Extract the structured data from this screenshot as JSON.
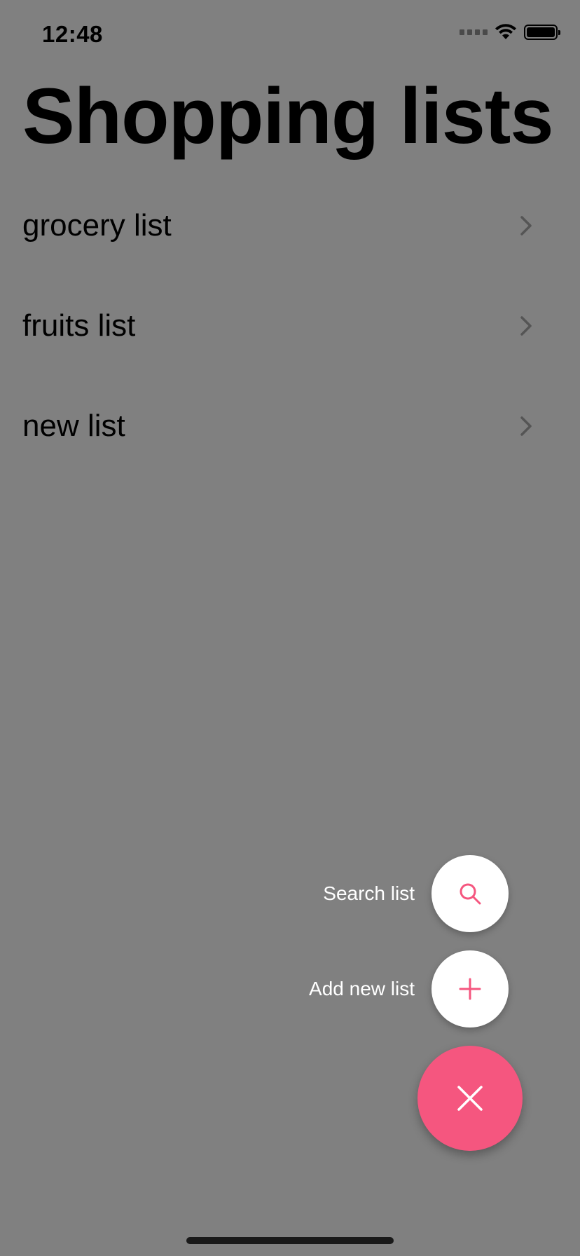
{
  "status_bar": {
    "time": "12:48"
  },
  "title": "Shopping lists",
  "lists": [
    {
      "label": "grocery list"
    },
    {
      "label": "fruits list"
    },
    {
      "label": "new list"
    }
  ],
  "actions": {
    "search_label": "Search list",
    "add_label": "Add new list"
  },
  "colors": {
    "accent": "#f5567f",
    "overlay": "#808080"
  },
  "icons": {
    "search": "search-icon",
    "add": "plus-icon",
    "close": "close-icon",
    "chevron": "chevron-right-icon"
  }
}
